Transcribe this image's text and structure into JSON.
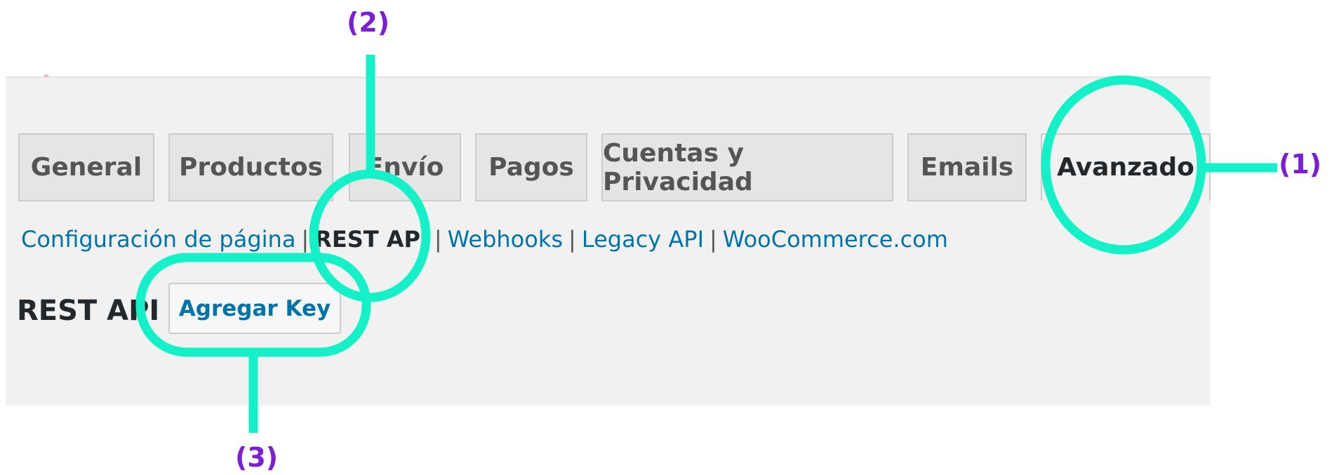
{
  "tabs": [
    {
      "label": "General"
    },
    {
      "label": "Productos"
    },
    {
      "label": "Envío"
    },
    {
      "label": "Pagos"
    },
    {
      "label": "Cuentas y Privacidad"
    },
    {
      "label": "Emails"
    },
    {
      "label": "Avanzado",
      "active": true
    }
  ],
  "subnav": {
    "items": [
      {
        "label": "Configuración de página"
      },
      {
        "label": "REST API",
        "current": true
      },
      {
        "label": "Webhooks"
      },
      {
        "label": "Legacy API"
      },
      {
        "label": "WooCommerce.com"
      }
    ],
    "separator": "|"
  },
  "page": {
    "heading": "REST API",
    "add_key_button": "Agregar Key"
  },
  "callouts": {
    "one": "(1)",
    "two": "(2)",
    "three": "(3)"
  },
  "colors": {
    "highlight": "#14f0c8",
    "callout_text": "#7a1fd6",
    "link": "#0073aa",
    "panel_background": "#f1f1f1"
  }
}
